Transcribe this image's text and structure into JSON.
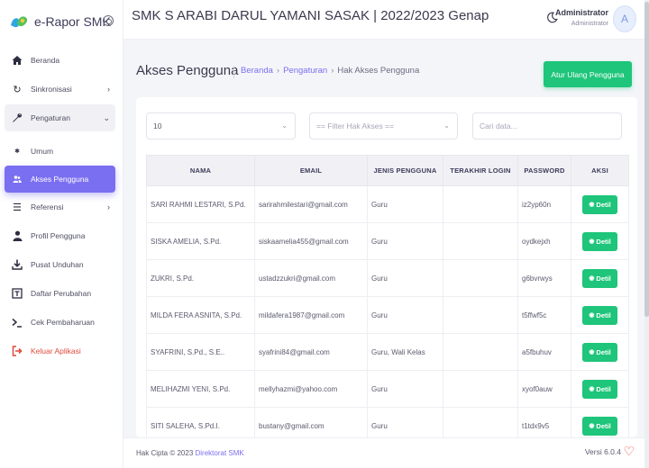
{
  "brand": {
    "name": "e-Rapor SMK"
  },
  "header": {
    "title": "SMK S ARABI DARUL YAMANI SASAK | 2022/2023 Genap",
    "user_name": "Administrator",
    "user_role": "Administrator",
    "avatar_initial": "A"
  },
  "sidebar": {
    "items": [
      {
        "label": "Beranda",
        "icon": "home-icon"
      },
      {
        "label": "Sinkronisasi",
        "icon": "sync-icon"
      },
      {
        "label": "Pengaturan",
        "icon": "wrench-icon"
      },
      {
        "label": "Umum",
        "icon": "gear-icon"
      },
      {
        "label": "Akses Pengguna",
        "icon": "users-icon"
      },
      {
        "label": "Referensi",
        "icon": "list-icon"
      },
      {
        "label": "Profil Pengguna",
        "icon": "user-icon"
      },
      {
        "label": "Pusat Unduhan",
        "icon": "download-icon"
      },
      {
        "label": "Daftar Perubahan",
        "icon": "changelog-icon"
      },
      {
        "label": "Cek Pembaharuan",
        "icon": "terminal-icon"
      },
      {
        "label": "Keluar Aplikasi",
        "icon": "logout-icon"
      }
    ]
  },
  "page": {
    "title": "Akses Pengguna",
    "breadcrumb": [
      "Beranda",
      "Pengaturan",
      "Hak Akses Pengguna"
    ],
    "reset_button": "Atur Ulang Pengguna"
  },
  "filters": {
    "per_page": "10",
    "role_filter": "== Filter Hak Akses ==",
    "search_placeholder": "Cari data..."
  },
  "table": {
    "headers": [
      "NAMA",
      "EMAIL",
      "JENIS PENGGUNA",
      "TERAKHIR LOGIN",
      "PASSWORD",
      "AKSI"
    ],
    "action_label": "Detil",
    "rows": [
      {
        "nama": "SARI RAHMI LESTARI, S.Pd.",
        "email": "sarirahmilestari@gmail.com",
        "jenis": "Guru",
        "login": "",
        "password": "iz2yp60n"
      },
      {
        "nama": "SISKA AMELIA, S.Pd.",
        "email": "siskaamelia455@gmail.com",
        "jenis": "Guru",
        "login": "",
        "password": "oydkejxh"
      },
      {
        "nama": "ZUKRI, S.Pd.",
        "email": "ustadzzukri@gmail.com",
        "jenis": "Guru",
        "login": "",
        "password": "g6bvrwys"
      },
      {
        "nama": "MILDA FERA ASNITA, S.Pd.",
        "email": "mildafera1987@gmail.com",
        "jenis": "Guru",
        "login": "",
        "password": "t5ffwf5c"
      },
      {
        "nama": "SYAFRINI, S.Pd., S.E..",
        "email": "syafrini84@gmail.com",
        "jenis": "Guru, Wali Kelas",
        "login": "",
        "password": "a5fbuhuv"
      },
      {
        "nama": "MELIHAZMI YENI, S.Pd.",
        "email": "mellyhazmi@yahoo.com",
        "jenis": "Guru",
        "login": "",
        "password": "xyof0auw"
      },
      {
        "nama": "SITI SALEHA, S.Pd.I.",
        "email": "bustany@gmail.com",
        "jenis": "Guru",
        "login": "",
        "password": "t1tdx9v5"
      }
    ]
  },
  "footer": {
    "copyright": "Hak Cipta © 2023",
    "link": "Direktorat SMK",
    "version": "Versi 6.0.4"
  },
  "colors": {
    "primary": "#7a6ff0",
    "success": "#1ec57a",
    "danger": "#e0493b"
  }
}
